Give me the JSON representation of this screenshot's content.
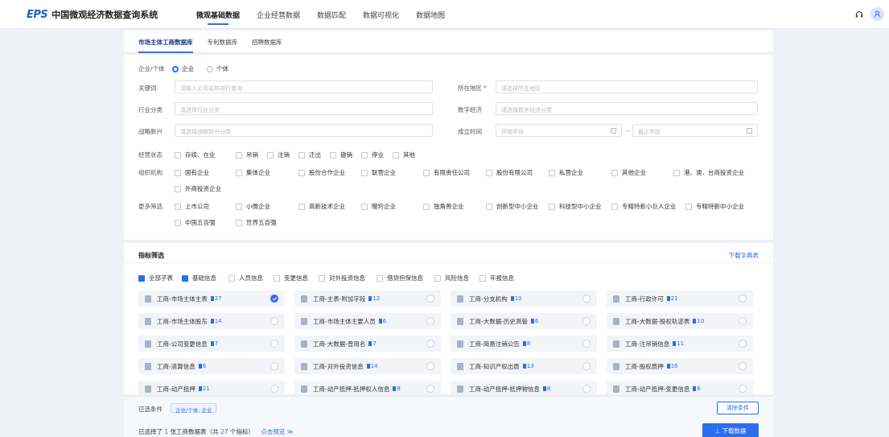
{
  "app": {
    "logo": "EPS",
    "title": "中国微观经济数据查询系统"
  },
  "nav": [
    "微观基础数据",
    "企业经营数据",
    "数据匹配",
    "数据可视化",
    "数据地图"
  ],
  "subtabs": [
    "市场主体工商数据库",
    "专利数据库",
    "招聘数据库"
  ],
  "entity": {
    "label": "企业/个体",
    "options": [
      "企业",
      "个体"
    ],
    "selected": "企业"
  },
  "fields": {
    "keyword": {
      "label": "关键词",
      "placeholder": "请输入公司名称进行查询"
    },
    "region": {
      "label": "所在地区",
      "required": "*",
      "placeholder": "请选择所在地区"
    },
    "industry": {
      "label": "行业分类",
      "placeholder": "请选择行业分类"
    },
    "digital": {
      "label": "数字经济",
      "placeholder": "请选择数字经济分类"
    },
    "strategic": {
      "label": "战略新兴",
      "placeholder": "请选择战略新兴分类"
    },
    "established": {
      "label": "成立时间",
      "start_placeholder": "开始年份",
      "sep": "—",
      "end_placeholder": "截止年份"
    }
  },
  "status": {
    "label": "经营状态",
    "options": [
      "存续、在业",
      "吊销",
      "注销",
      "迁出",
      "撤销",
      "停业",
      "其他"
    ]
  },
  "org": {
    "label": "组织机构",
    "options": [
      "国有企业",
      "集体企业",
      "股份合作企业",
      "联营企业",
      "有限责任公司",
      "股份有限公司",
      "私营企业",
      "其他企业",
      "港、澳、台商投资企业",
      "外商投资企业"
    ]
  },
  "more": {
    "label": "更多筛选",
    "options": [
      "上市公司",
      "小微企业",
      "高新技术企业",
      "瞪羚企业",
      "独角兽企业",
      "创新型中小企业",
      "科技型中小企业",
      "专精特新小巨人企业",
      "专精特新中小企业",
      "中国五百强",
      "世界五百强"
    ]
  },
  "indicators": {
    "title": "指标筛选",
    "download_dict": "下载字典表",
    "categories": [
      {
        "label": "全部子表",
        "checked": true
      },
      {
        "label": "基础信息",
        "checked": true
      },
      {
        "label": "人员信息",
        "checked": false
      },
      {
        "label": "变更信息",
        "checked": false
      },
      {
        "label": "对外投资信息",
        "checked": false
      },
      {
        "label": "借贷担保信息",
        "checked": false
      },
      {
        "label": "风险信息",
        "checked": false
      },
      {
        "label": "年报信息",
        "checked": false
      }
    ],
    "tables": [
      {
        "name": "工商-市场主体主表",
        "count": "27",
        "selected": true
      },
      {
        "name": "工商-主表-附加字段",
        "count": "12",
        "selected": false
      },
      {
        "name": "工商-分支机构",
        "count": "10",
        "selected": false
      },
      {
        "name": "工商-行政许可",
        "count": "21",
        "selected": false
      },
      {
        "name": "工商-市场主体股东",
        "count": "14",
        "selected": false
      },
      {
        "name": "工商-市场主体主要人员",
        "count": "6",
        "selected": false
      },
      {
        "name": "工商-大数据-历史高管",
        "count": "6",
        "selected": false
      },
      {
        "name": "工商-大数据-股权轨迹表",
        "count": "10",
        "selected": false
      },
      {
        "name": "工商-公司变更信息",
        "count": "7",
        "selected": false
      },
      {
        "name": "工商-大数据-曾用名",
        "count": "7",
        "selected": false
      },
      {
        "name": "工商-简易注销公告",
        "count": "8",
        "selected": false
      },
      {
        "name": "工商-注吊销信息",
        "count": "11",
        "selected": false
      },
      {
        "name": "工商-清算信息",
        "count": "6",
        "selected": false
      },
      {
        "name": "工商-对外投资信息",
        "count": "14",
        "selected": false
      },
      {
        "name": "工商-知识产权出质",
        "count": "13",
        "selected": false
      },
      {
        "name": "工商-股权质押",
        "count": "16",
        "selected": false
      },
      {
        "name": "工商-动产抵押",
        "count": "21",
        "selected": false
      },
      {
        "name": "工商-动产抵押-抵押权人信息",
        "count": "8",
        "selected": false
      },
      {
        "name": "工商-动产抵押-抵押物信息",
        "count": "8",
        "selected": false
      },
      {
        "name": "工商-动产抵押-变更信息",
        "count": "6",
        "selected": false
      }
    ]
  },
  "footer": {
    "chosen_label": "已选条件",
    "chip": "企业/个体: 企业",
    "clear": "清除条件",
    "summary_a": "已选择了",
    "summary_n1": "1",
    "summary_b": "张工商数据表（共",
    "summary_n2": "27",
    "summary_c": "个指标）",
    "preview": "点击预览 ≫",
    "download": "⊥ 下载数据"
  }
}
